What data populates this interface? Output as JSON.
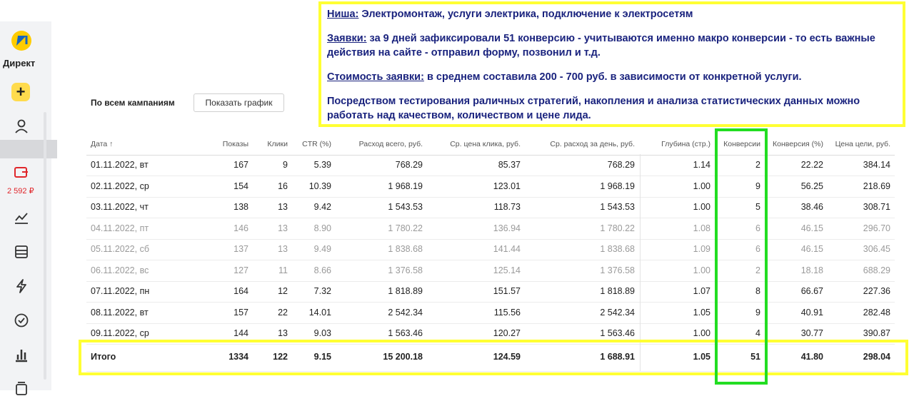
{
  "sidebar": {
    "logo_text": "Директ",
    "add_label": "+",
    "balance": "2 592 ₽",
    "icons": [
      "direct-logo-icon",
      "plus-icon",
      "user-icon",
      "wallet-icon",
      "chart-icon",
      "list-icon",
      "lightning-icon",
      "check-circle-icon",
      "bar-chart-icon",
      "stack-icon"
    ]
  },
  "header": {
    "all_campaigns": "По всем кампаниям",
    "show_chart_button": "Показать график"
  },
  "table": {
    "columns": [
      "Дата ↑",
      "Показы",
      "Клики",
      "CTR (%)",
      "Расход всего, руб.",
      "Ср. цена клика, руб.",
      "Ср. расход за день, руб.",
      "Глубина (стр.)",
      "Конверсии",
      "Конверсия (%)",
      "Цена цели, руб."
    ],
    "rows": [
      [
        "01.11.2022, вт",
        "167",
        "9",
        "5.39",
        "768.29",
        "85.37",
        "768.29",
        "1.14",
        "2",
        "22.22",
        "384.14"
      ],
      [
        "02.11.2022, ср",
        "154",
        "16",
        "10.39",
        "1 968.19",
        "123.01",
        "1 968.19",
        "1.00",
        "9",
        "56.25",
        "218.69"
      ],
      [
        "03.11.2022, чт",
        "138",
        "13",
        "9.42",
        "1 543.53",
        "118.73",
        "1 543.53",
        "1.00",
        "5",
        "38.46",
        "308.71"
      ],
      [
        "04.11.2022, пт",
        "146",
        "13",
        "8.90",
        "1 780.22",
        "136.94",
        "1 780.22",
        "1.08",
        "6",
        "46.15",
        "296.70"
      ],
      [
        "05.11.2022, сб",
        "137",
        "13",
        "9.49",
        "1 838.68",
        "141.44",
        "1 838.68",
        "1.09",
        "6",
        "46.15",
        "306.45"
      ],
      [
        "06.11.2022, вс",
        "127",
        "11",
        "8.66",
        "1 376.58",
        "125.14",
        "1 376.58",
        "1.00",
        "2",
        "18.18",
        "688.29"
      ],
      [
        "07.11.2022, пн",
        "164",
        "12",
        "7.32",
        "1 818.89",
        "151.57",
        "1 818.89",
        "1.07",
        "8",
        "66.67",
        "227.36"
      ],
      [
        "08.11.2022, вт",
        "157",
        "22",
        "14.01",
        "2 542.34",
        "115.56",
        "2 542.34",
        "1.05",
        "9",
        "40.91",
        "282.48"
      ],
      [
        "09.11.2022, ср",
        "144",
        "13",
        "9.03",
        "1 563.46",
        "120.27",
        "1 563.46",
        "1.00",
        "4",
        "30.77",
        "390.87"
      ]
    ],
    "muted_rows": [
      3,
      4,
      5
    ],
    "total": [
      "Итого",
      "1334",
      "122",
      "9.15",
      "15 200.18",
      "124.59",
      "1 688.91",
      "1.05",
      "51",
      "41.80",
      "298.04"
    ]
  },
  "annotation": {
    "niche_label": "Ниша:",
    "niche_text": " Электромонтаж, услуги электрика, подключение к электросетям",
    "leads_label": "Заявки:",
    "leads_text": " за 9 дней зафиксировали 51 конверсию - учитываются именно макро конверсии - то есть важные действия на сайте - отправил форму, позвонил и т.д.",
    "cost_label": "Стоимость заявки:",
    "cost_text": " в среднем составила 200 - 700 руб. в зависимости от конкретной услуги.",
    "summary": "Посредством тестирования раличных стратегий, накопления и анализа статистических данных можно работать над качеством, количеством и цене лида."
  },
  "colors": {
    "highlight_yellow": "#ffff33",
    "highlight_green": "#22dd22",
    "annotation_text": "#1a237e",
    "balance_red": "#e0262b"
  }
}
